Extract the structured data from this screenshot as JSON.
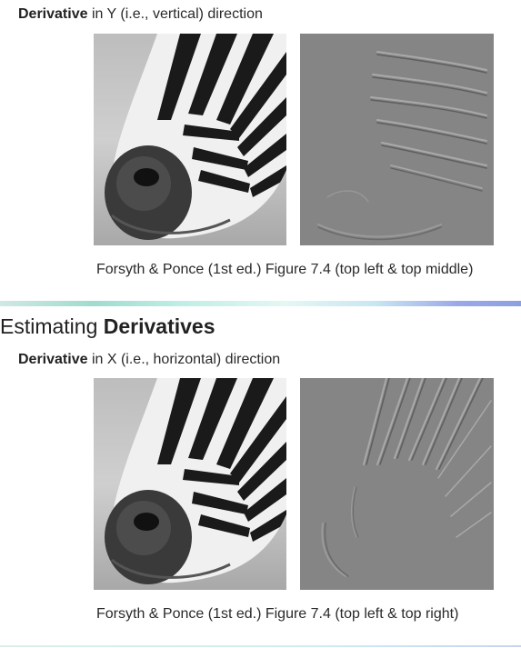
{
  "slide_top": {
    "subtitle_bold": "Derivative",
    "subtitle_rest": " in Y (i.e., vertical) direction",
    "caption": "Forsyth & Ponce (1st ed.) Figure 7.4 (top left & top middle)"
  },
  "slide_bottom": {
    "title_plain": "Estimating ",
    "title_bold": "Derivatives",
    "subtitle_bold": "Derivative",
    "subtitle_rest": " in X (i.e., horizontal) direction",
    "caption": "Forsyth & Ponce (1st ed.) Figure 7.4 (top left & top right)"
  },
  "colors": {
    "gradient_gray": "#858585",
    "accent_teal": "#9fdccf",
    "accent_blue": "#8ca0e0"
  }
}
